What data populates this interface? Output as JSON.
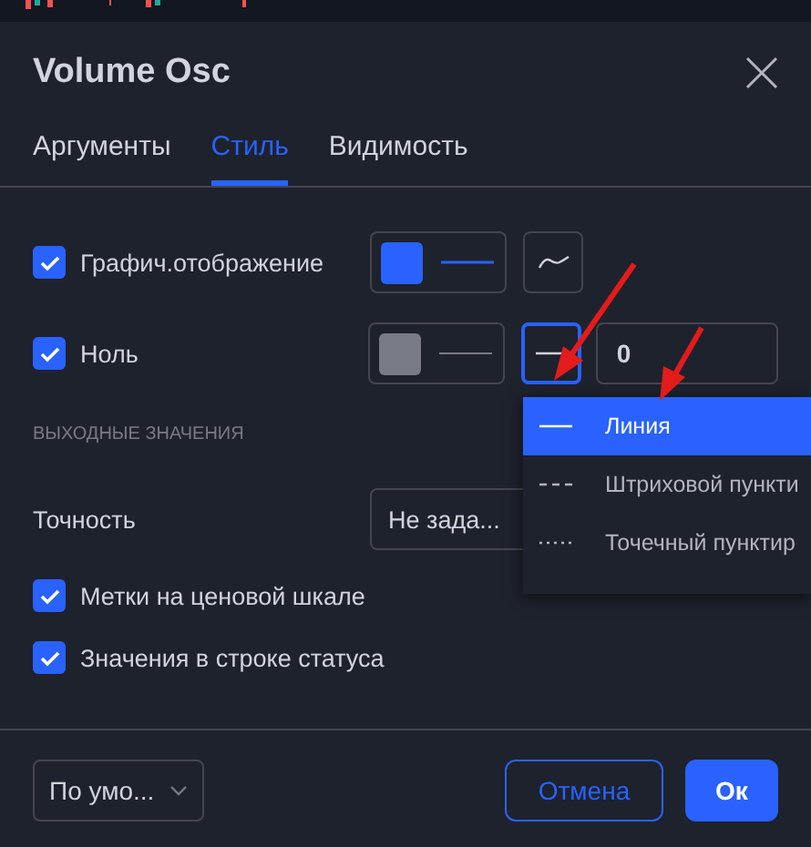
{
  "dialog": {
    "title": "Volume Osc"
  },
  "tabs": [
    {
      "label": "Аргументы",
      "selected": false
    },
    {
      "label": "Стиль",
      "selected": true
    },
    {
      "label": "Видимость",
      "selected": false
    }
  ],
  "plots": [
    {
      "kind": "plot",
      "label": "Графич.отображение",
      "checked": true,
      "color": "#2962ff",
      "menu_open": false
    },
    {
      "kind": "level",
      "label": "Ноль",
      "checked": true,
      "color": "#787b86",
      "value": "0",
      "menu_open": true
    }
  ],
  "line_style_menu": {
    "items": [
      {
        "label": "Линия",
        "kind": "solid",
        "selected": true
      },
      {
        "label": "Штриховой пункти",
        "kind": "dashed",
        "selected": false
      },
      {
        "label": "Точечный пунктир",
        "kind": "dotted",
        "selected": false
      }
    ]
  },
  "section_heading": "ВЫХОДНЫЕ ЗНАЧЕНИЯ",
  "precision": {
    "label": "Точность",
    "value": "Не зада..."
  },
  "options": [
    {
      "label": "Метки на ценовой шкале",
      "checked": true
    },
    {
      "label": "Значения в строке статуса",
      "checked": true
    }
  ],
  "footer": {
    "defaults": "По умо...",
    "cancel": "Отмена",
    "ok": "Ок"
  }
}
